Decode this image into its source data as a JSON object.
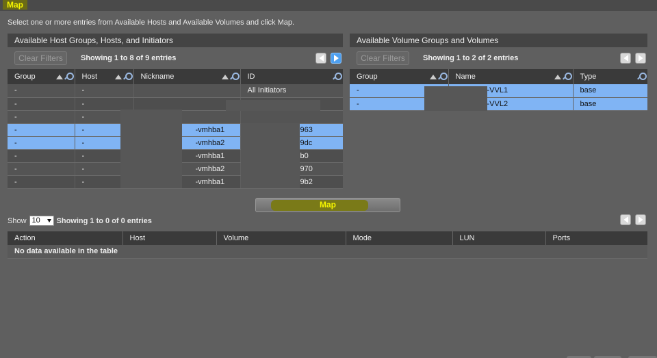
{
  "page": {
    "title": "Map",
    "instructions": "Select one or more entries from Available Hosts and Available Volumes and click Map."
  },
  "hosts_panel": {
    "header": "Available Host Groups, Hosts, and Initiators",
    "clear_filters": "Clear Filters",
    "showing": "Showing 1 to 8 of 9 entries",
    "columns": [
      "Group",
      "Host",
      "Nickname",
      "ID"
    ],
    "rows": [
      {
        "group": "-",
        "host": "-",
        "nickname": "",
        "id": "All Initiators",
        "selected": false
      },
      {
        "group": "-",
        "host": "-",
        "nickname": "",
        "id": "",
        "selected": false
      },
      {
        "group": "-",
        "host": "-",
        "nickname": "",
        "id": "",
        "selected": false
      },
      {
        "group": "-",
        "host": "-",
        "nickname": "-vmhba1",
        "id": "963",
        "selected": true
      },
      {
        "group": "-",
        "host": "-",
        "nickname": "-vmhba2",
        "id": "9dc",
        "selected": true
      },
      {
        "group": "-",
        "host": "-",
        "nickname": "-vmhba1",
        "id": "b0",
        "selected": false
      },
      {
        "group": "-",
        "host": "-",
        "nickname": "-vmhba2",
        "id": "970",
        "selected": false
      },
      {
        "group": "-",
        "host": "-",
        "nickname": "-vmhba1",
        "id": "9b2",
        "selected": false
      }
    ]
  },
  "volumes_panel": {
    "header": "Available Volume Groups and Volumes",
    "clear_filters": "Clear Filters",
    "showing": "Showing 1 to 2 of 2 entries",
    "columns": [
      "Group",
      "Name",
      "Type"
    ],
    "rows": [
      {
        "group": "-",
        "name": "-VVL1",
        "type": "base",
        "selected": true
      },
      {
        "group": "-",
        "name": "-VVL2",
        "type": "base",
        "selected": true
      }
    ]
  },
  "map_button": "Map",
  "mappings": {
    "show_label": "Show",
    "page_size": "10",
    "showing": "Showing 1 to 0 of 0 entries",
    "columns": [
      "Action",
      "Host",
      "Volume",
      "Mode",
      "LUN",
      "Ports"
    ],
    "empty_text": "No data available in the table"
  }
}
